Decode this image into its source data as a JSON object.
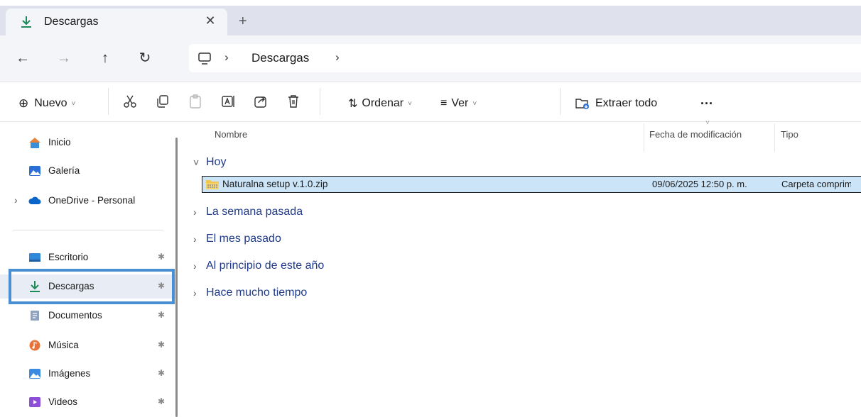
{
  "tab": {
    "title": "Descargas",
    "close_glyph": "✕",
    "new_tab_glyph": "+",
    "icon": "download-icon"
  },
  "nav": {
    "back": "←",
    "forward": "→",
    "up": "↑",
    "refresh": "↻"
  },
  "address": {
    "root_icon": "pc-icon",
    "separator": "›",
    "crumb": "Descargas"
  },
  "toolbar": {
    "new_label": "Nuevo",
    "sort_label": "Ordenar",
    "view_label": "Ver",
    "extract_label": "Extraer todo",
    "more_label": "···",
    "caret": "˅",
    "sort_glyph": "⇅",
    "view_glyph": "≡",
    "new_glyph": "⊕"
  },
  "sidebar": {
    "items": [
      {
        "label": "Inicio",
        "icon": "home-icon"
      },
      {
        "label": "Galería",
        "icon": "gallery-icon"
      },
      {
        "label": "OneDrive - Personal",
        "icon": "cloud-icon"
      },
      {
        "label": "Escritorio",
        "icon": "desktop-icon"
      },
      {
        "label": "Descargas",
        "icon": "download-icon"
      },
      {
        "label": "Documentos",
        "icon": "documents-icon"
      },
      {
        "label": "Música",
        "icon": "music-icon"
      },
      {
        "label": "Imágenes",
        "icon": "pictures-icon"
      },
      {
        "label": "Videos",
        "icon": "videos-icon"
      }
    ],
    "pin_glyph": "📌",
    "expand_glyph": "›"
  },
  "list": {
    "columns": [
      "Nombre",
      "Fecha de modificación",
      "Tipo"
    ],
    "groups": [
      "Hoy",
      "La semana pasada",
      "El mes pasado",
      "Al principio de este año",
      "Hace mucho tiempo"
    ],
    "files": [
      {
        "name": "Naturalna setup v.1.0.zip",
        "modified": "09/06/2025 12:50 p. m.",
        "type": "Carpeta comprimida"
      }
    ],
    "expanded_glyph": "˅",
    "collapsed_glyph": "›"
  }
}
